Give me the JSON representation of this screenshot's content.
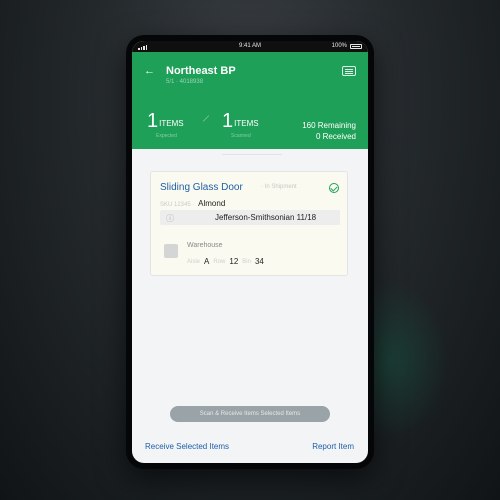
{
  "status_bar": {
    "time": "9:41 AM",
    "battery": "100%"
  },
  "header": {
    "title": "Northeast BP",
    "subtitle": "5/1 · 4018938",
    "items_left": {
      "count": "1",
      "unit": "ITEMS",
      "sub": "Expected"
    },
    "items_right": {
      "count": "1",
      "unit": "ITEMS",
      "sub": "Scanned"
    },
    "remaining": "160 Remaining",
    "received": "0 Received",
    "accent_color": "#1ea058"
  },
  "card": {
    "title": "Sliding Glass Door",
    "status": "· In Shipment",
    "meta_prefix": "SKU 12345 ·",
    "meta_value": "Almond",
    "field_text": "Jefferson-Smithsonian  11/18",
    "location_label": "Warehouse",
    "aisle_label": "Aisle",
    "aisle_value": "A",
    "row_label": "Row",
    "row_value": "12",
    "bin_label": "Bin",
    "bin_value": "34"
  },
  "bottom": {
    "pill_text": "Scan & Receive Items Selected Items",
    "receive_label": "Receive Selected Items",
    "report_label": "Report Item"
  },
  "icons": [
    "back-arrow-icon",
    "keyboard-icon",
    "check-circle-icon",
    "info-icon",
    "box-icon",
    "signal-icon",
    "battery-icon"
  ]
}
